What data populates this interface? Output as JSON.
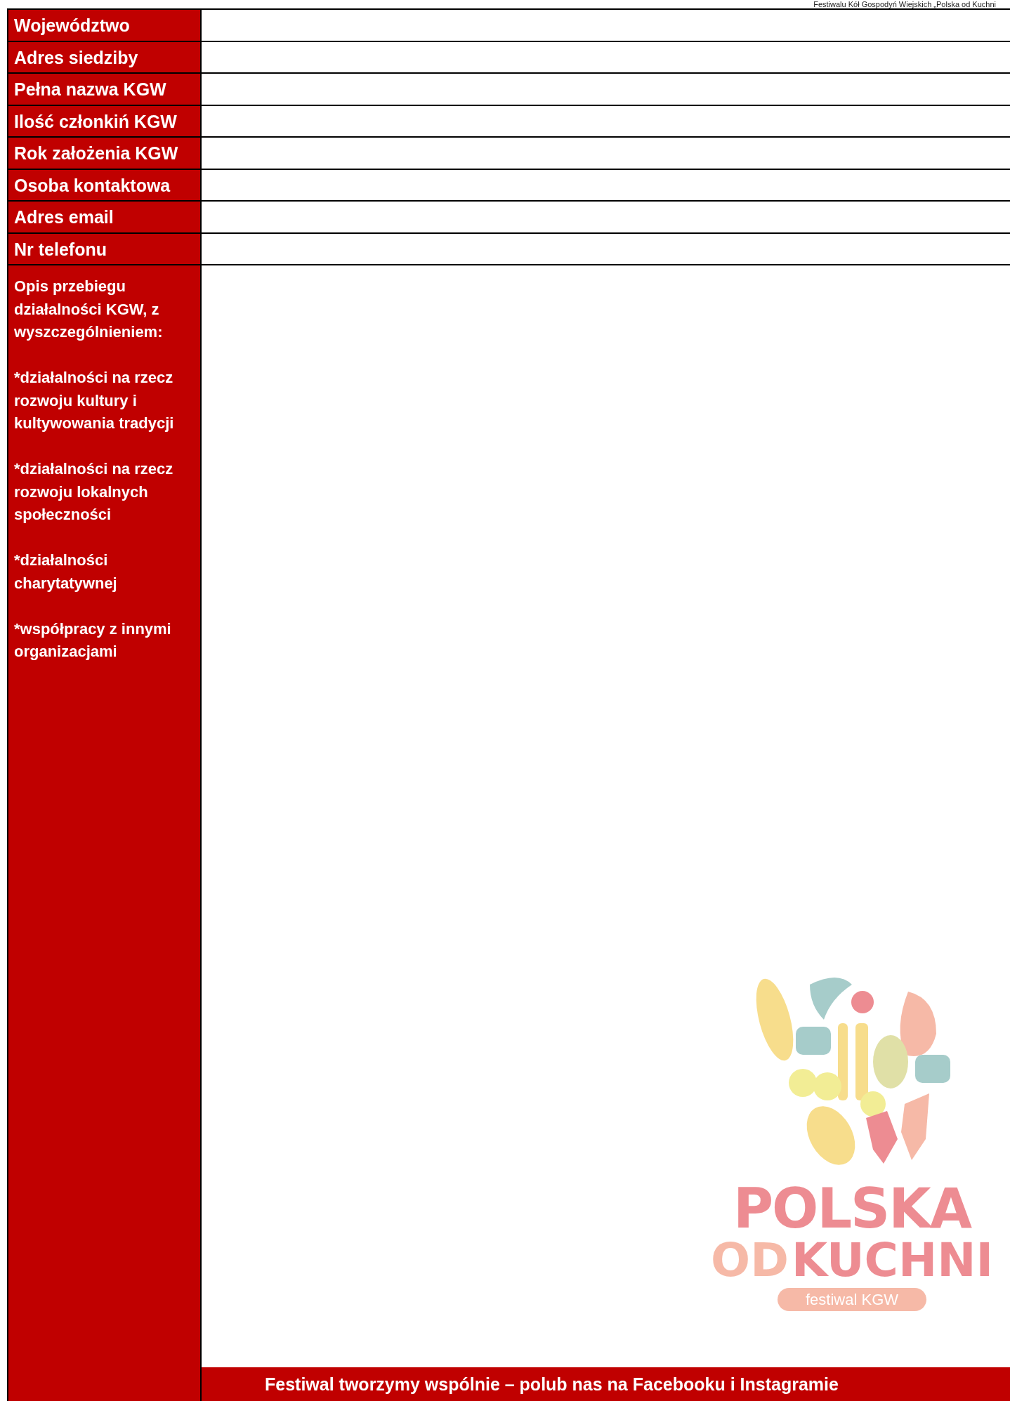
{
  "page_header": "Festiwalu Kół Gospodyń Wiejskich „Polska od Kuchni",
  "fields": [
    {
      "label": "Województwo"
    },
    {
      "label": "Adres siedziby"
    },
    {
      "label": "Pełna nazwa KGW"
    },
    {
      "label": "Ilość członkiń KGW"
    },
    {
      "label": "Rok założenia KGW"
    },
    {
      "label": "Osoba kontaktowa"
    },
    {
      "label": "Adres email"
    },
    {
      "label": "Nr telefonu"
    }
  ],
  "description": {
    "paragraphs": [
      "Opis przebiegu działalności KGW, z wyszczególnieniem:",
      "*działalności na rzecz rozwoju kultury i kultywowania tradycji",
      "*działalności na rzecz rozwoju lokalnych społeczności",
      "*działalności charytatywnej",
      "*współpracy z innymi organizacjami"
    ]
  },
  "logo": {
    "line_1": "POLSKA",
    "line_2a": "OD",
    "line_2b": "KUCHNI",
    "tagline": "festiwal KGW"
  },
  "footer": "Festiwal tworzymy wspólnie – polub nas na Facebooku i Instagramie"
}
